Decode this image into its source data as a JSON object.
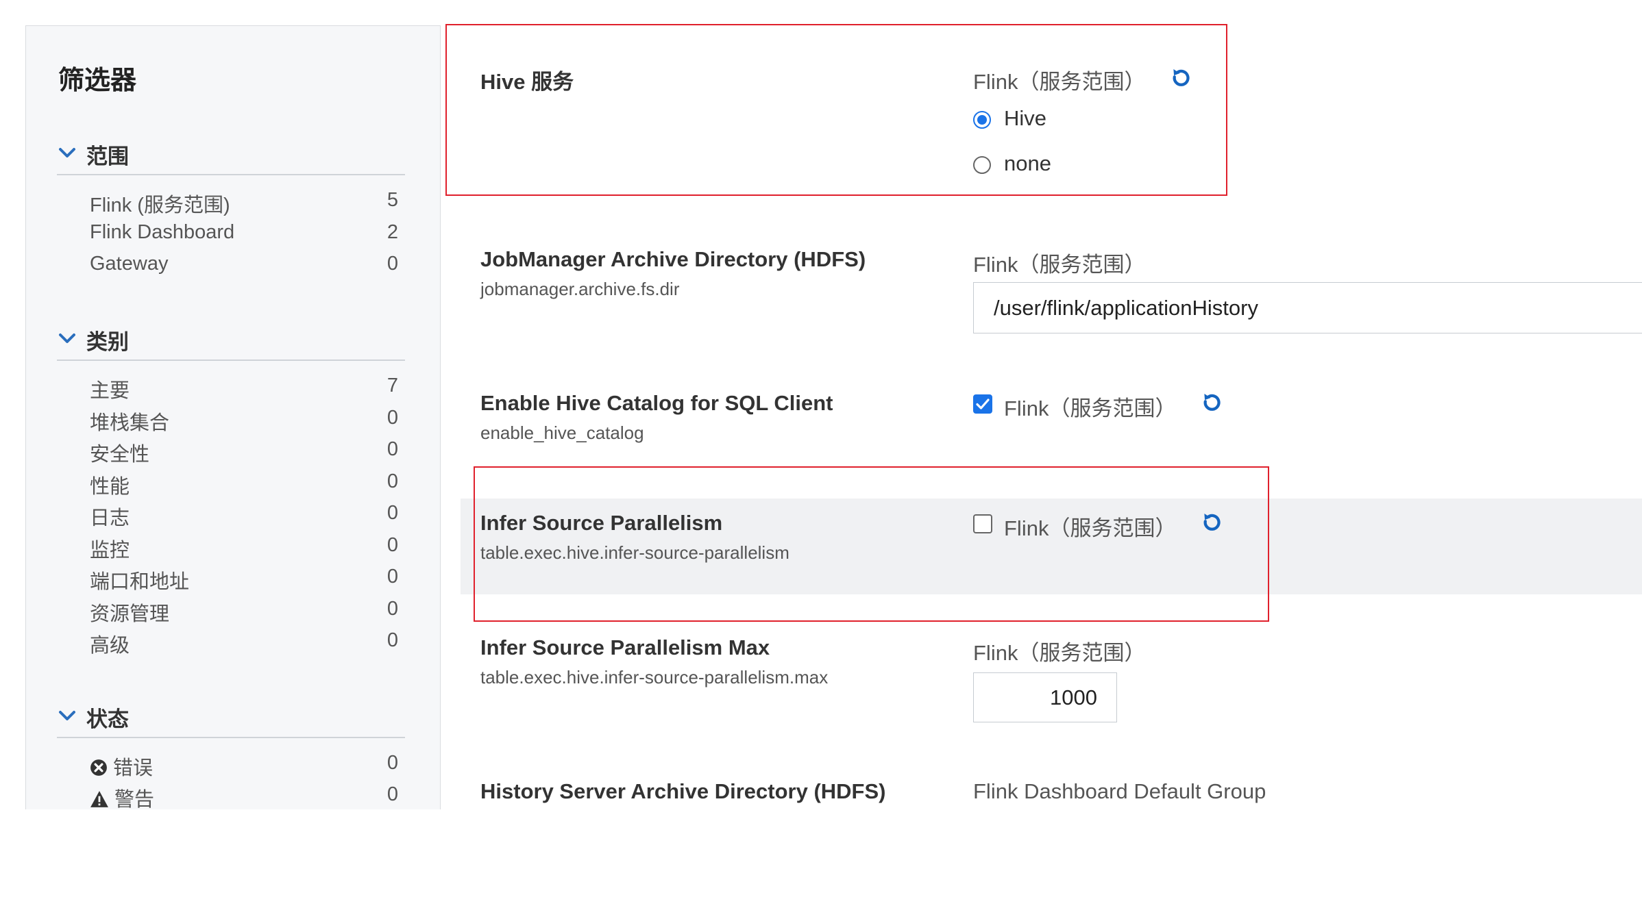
{
  "filters": {
    "title": "筛选器",
    "groups": [
      {
        "label": "范围",
        "items": [
          {
            "label": "Flink (服务范围)",
            "count": "5"
          },
          {
            "label": "Flink Dashboard",
            "count": "2"
          },
          {
            "label": "Gateway",
            "count": "0"
          }
        ]
      },
      {
        "label": "类别",
        "items": [
          {
            "label": "主要",
            "count": "7"
          },
          {
            "label": "堆栈集合",
            "count": "0"
          },
          {
            "label": "安全性",
            "count": "0"
          },
          {
            "label": "性能",
            "count": "0"
          },
          {
            "label": "日志",
            "count": "0"
          },
          {
            "label": "监控",
            "count": "0"
          },
          {
            "label": "端口和地址",
            "count": "0"
          },
          {
            "label": "资源管理",
            "count": "0"
          },
          {
            "label": "高级",
            "count": "0"
          }
        ]
      },
      {
        "label": "状态",
        "items": [
          {
            "label": "错误",
            "count": "0",
            "icon": "error-circle-icon"
          },
          {
            "label": "警告",
            "count": "0",
            "icon": "warning-triangle-icon"
          }
        ]
      }
    ]
  },
  "properties": [
    {
      "name": "Hive 服务",
      "scope": "Flink（服务范围）",
      "options": [
        {
          "label": "Hive",
          "selected": true
        },
        {
          "label": "none",
          "selected": false
        }
      ]
    },
    {
      "name": "JobManager Archive Directory (HDFS)",
      "key": "jobmanager.archive.fs.dir",
      "scope": "Flink（服务范围）",
      "value": "/user/flink/applicationHistory"
    },
    {
      "name": "Enable Hive Catalog for SQL Client",
      "key": "enable_hive_catalog",
      "scope": "Flink（服务范围）",
      "checked": true
    },
    {
      "name": "Infer Source Parallelism",
      "key": "table.exec.hive.infer-source-parallelism",
      "scope": "Flink（服务范围）",
      "checked": false
    },
    {
      "name": "Infer Source Parallelism Max",
      "key": "table.exec.hive.infer-source-parallelism.max",
      "scope": "Flink（服务范围）",
      "value": "1000"
    },
    {
      "name": "History Server Archive Directory (HDFS)",
      "scope": "Flink Dashboard Default Group"
    }
  ],
  "colors": {
    "accent": "#1a73e8",
    "highlight_border": "#e0202c",
    "reset_icon": "#1565c0",
    "sidebar_bg": "#f6f7f9",
    "row_highlight": "#f0f1f3"
  }
}
